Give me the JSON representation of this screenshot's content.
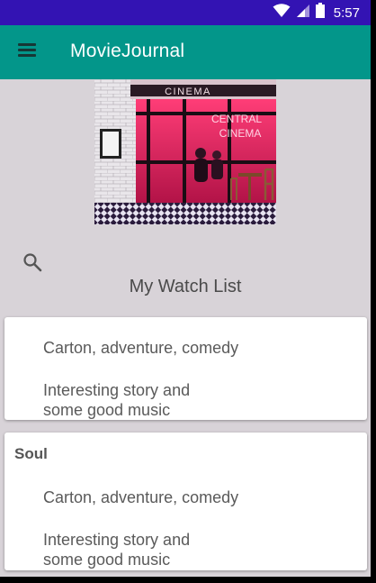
{
  "status_bar": {
    "time": "5:57",
    "icons": [
      "wifi-icon",
      "signal-icon",
      "battery-icon"
    ],
    "color": "#3313b3"
  },
  "app_bar": {
    "title": "MovieJournal",
    "menu_icon": "menu-icon",
    "color": "#03968a"
  },
  "hero": {
    "icon": "cinema-storefront-photo",
    "signs": [
      "CINEMA",
      "CENTRAL",
      "CINEMA"
    ]
  },
  "search": {
    "icon": "search-icon"
  },
  "watch_list": {
    "title": "My Watch List",
    "items": [
      {
        "title": "",
        "genre": "Carton, adventure, comedy",
        "note_line1": "Interesting story and",
        "note_line2": "some good music"
      },
      {
        "title": "Soul",
        "genre": "Carton, adventure, comedy",
        "note_line1": "Interesting story and",
        "note_line2": "some good music"
      }
    ]
  }
}
